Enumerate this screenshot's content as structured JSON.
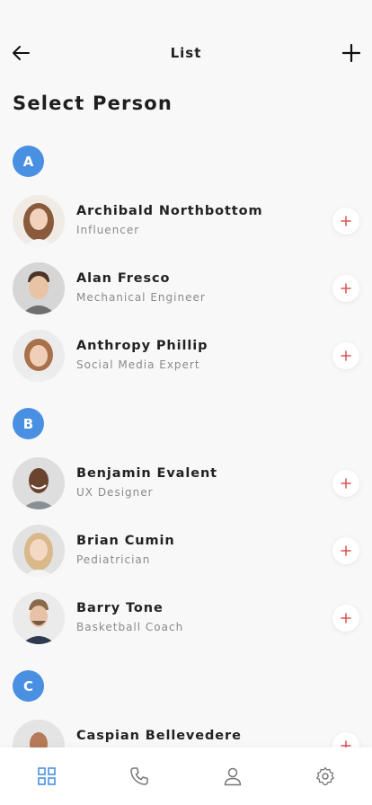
{
  "header": {
    "title": "List",
    "back_icon": "arrow-left-icon",
    "add_icon": "plus-icon"
  },
  "page_heading": "Select Person",
  "colors": {
    "accent": "#4a90e2",
    "add_plus": "#d9534f",
    "background": "#f8f8f8"
  },
  "sections": [
    {
      "letter": "A",
      "people": [
        {
          "name": "Archibald Northbottom",
          "role": "Influencer"
        },
        {
          "name": "Alan Fresco",
          "role": "Mechanical Engineer"
        },
        {
          "name": "Anthropy Phillip",
          "role": "Social Media Expert"
        }
      ]
    },
    {
      "letter": "B",
      "people": [
        {
          "name": "Benjamin Evalent",
          "role": "UX Designer"
        },
        {
          "name": "Brian Cumin",
          "role": "Pediatrician"
        },
        {
          "name": "Barry Tone",
          "role": "Basketball Coach"
        }
      ]
    },
    {
      "letter": "C",
      "people": [
        {
          "name": "Caspian Bellevedere",
          "role": ""
        }
      ]
    }
  ],
  "bottom_nav": [
    {
      "icon": "grid-icon",
      "active": true
    },
    {
      "icon": "phone-icon",
      "active": false
    },
    {
      "icon": "user-icon",
      "active": false
    },
    {
      "icon": "settings-icon",
      "active": false
    }
  ]
}
